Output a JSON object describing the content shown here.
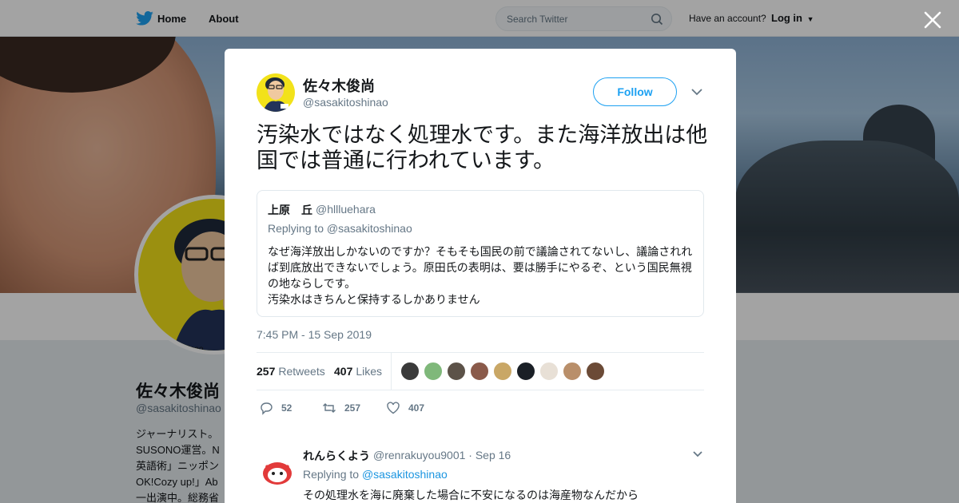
{
  "nav": {
    "home_label": "Home",
    "about_label": "About",
    "search_placeholder": "Search Twitter",
    "have_account": "Have an account?",
    "login_label": "Log in"
  },
  "profile": {
    "name": "佐々木俊尚",
    "handle": "@sasakitoshinao",
    "avatar_handle": "shinao",
    "bio": "ジャーナリスト。\nSUSONO運営。N\n英語術」ニッポン\nOK!Cozy up!」Ab\n一出演中。総務省"
  },
  "tweet": {
    "author_name": "佐々木俊尚",
    "author_handle": "@sasakitoshinao",
    "follow_label": "Follow",
    "text": "汚染水ではなく処理水です。また海洋放出は他国では普通に行われています。",
    "timestamp": "7:45 PM - 15 Sep 2019",
    "retweets_count": "257",
    "retweets_label": "Retweets",
    "likes_count": "407",
    "likes_label": "Likes",
    "likers": [
      "#3a3a3a",
      "#7fb87a",
      "#5c5248",
      "#8a5a4a",
      "#c9a766",
      "#1a1f26",
      "#e8e0d6",
      "#b98f6a",
      "#6b4a36"
    ],
    "actions": {
      "replies": "52",
      "retweets": "257",
      "likes": "407"
    },
    "quote": {
      "name": "上原　丘",
      "handle": "@hllluehara",
      "replying_to": "Replying to @sasakitoshinao",
      "body": "なぜ海洋放出しかないのですか？そもそも国民の前で議論されてないし、議論されれば到底放出できないでしょう。原田氏の表明は、要は勝手にやるぞ、という国民無視の地ならしです。\n汚染水はきちんと保持するしかありません"
    }
  },
  "reply": {
    "name": "れんらくよう",
    "handle_date": "@renrakuyou9001 · Sep 16",
    "replying_prefix": "Replying to",
    "replying_handle": "@sasakitoshinao",
    "body": "その処理水を海に廃棄した場合に不安になるのは海産物なんだから"
  },
  "colors": {
    "twitter_blue": "#1da1f2",
    "link_blue": "#1b95e0",
    "text_primary": "#14171a",
    "text_secondary": "#657786",
    "avatar_yellow": "#f2e21a"
  }
}
